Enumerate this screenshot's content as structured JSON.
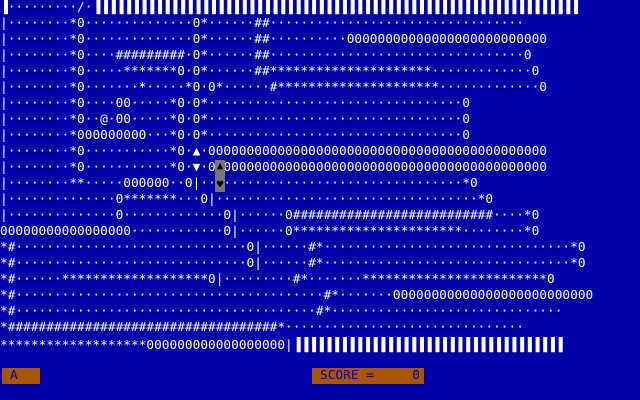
{
  "game": {
    "rows": [
      "▐·········/·▐▐▐▐▐▐▐▐▐▐▐▐▐▐▐▐▐▐▐▐▐▐▐▐▐▐▐▐▐▐▐▐▐▐▐▐▐▐▐▐▐▐▐▐▐▐▐▐▐▐▐▐▐▐▐▐▐▐▐▐▐▐▐",
      "|········*0··············0*······##·································",
      "|········*0··············0*······##··········00000000000000000000000000",
      "|········*0····#########·0*······##·································0",
      "|········*0·····*******0·0*······##*********************·············0",
      "|········*0·······*·····*0·0*······#*********************·············0",
      "|········*0····00·····*0·0*·································0",
      "|········*0··@·00·····*0·0*·································0",
      "|········*000000000···*0·0*·································0",
      "|········*0···········*0·▲·00000000000000000000000000000000000000000000",
      "|········*0···········*0·▼·00000000000000000000000000000000000000000000",
      "|········**·····000000··0|··································*0",
      "|··············0*******···0|··································*0",
      "|··············0·············0|······0##########################····*0",
      "00000000000000000············0|······0**********************········*0",
      "*#······························0|······#*································*0",
      "*#······························0|······#*································*0",
      "*#······*******************0|·········#*·······************************0",
      "*#········································#*·······00000000000000000000000000",
      "*#·······································#*······························",
      "*###################################*·······························",
      "*******************000000000000000000|▐▐▐▐▐▐▐▐▐▐▐▐▐▐▐▐▐▐▐▐▐▐▐▐▐▐▐▐▐▐▐▐▐▐▐"
    ]
  },
  "status": {
    "key": "A",
    "score_label": "SCORE =",
    "score_value": "0"
  },
  "colors": {
    "background": "#0000aa",
    "text": "#ffffff",
    "status_box": "#aa5500",
    "player": "#777777"
  }
}
